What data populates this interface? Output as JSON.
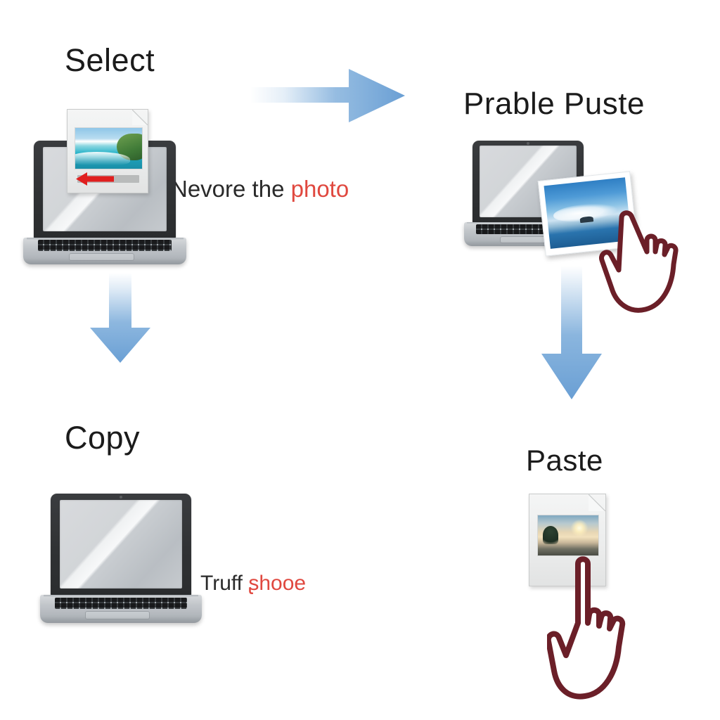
{
  "page": {
    "background_color": "#ffffff",
    "accent_arrow_color": "#6da3d6",
    "cursor_outline_color": "#6b1f28",
    "red_text_color": "#e0483f",
    "heading_text_color": "#1b1b1b"
  },
  "diagram": {
    "type": "four-step-flow",
    "steps": [
      {
        "id": "select",
        "heading": "Select",
        "caption_black": "Nevore the",
        "caption_red": "photo",
        "device": "laptop",
        "overlay_icon": "photo-file-icon",
        "photo_subject": "beach-ocean"
      },
      {
        "id": "prable-puste",
        "heading": "Prable Puste",
        "caption_black": "",
        "caption_red": "",
        "device": "laptop",
        "overlay_icon": "photo-thumbnail",
        "photo_subject": "sky-clouds",
        "cursor": "pointing-hand-cursor"
      },
      {
        "id": "copy",
        "heading": "Copy",
        "caption_black": "Truff",
        "caption_red": "ʂhooe",
        "device": "laptop",
        "overlay_icon": "",
        "photo_subject": ""
      },
      {
        "id": "paste",
        "heading": "Paste",
        "caption_black": "",
        "caption_red": "",
        "device": "document",
        "overlay_icon": "photo-file-icon",
        "photo_subject": "sunset-trees",
        "cursor": "pointing-hand-cursor"
      }
    ],
    "arrows": [
      {
        "id": "arrow-select-to-prable",
        "direction": "right",
        "style": "gradient-fade",
        "color": "#6da3d6"
      },
      {
        "id": "arrow-select-to-copy",
        "direction": "down",
        "style": "gradient-fade",
        "color": "#6da3d6"
      },
      {
        "id": "arrow-prable-to-paste",
        "direction": "down",
        "style": "gradient-fade",
        "color": "#6da3d6"
      }
    ]
  }
}
